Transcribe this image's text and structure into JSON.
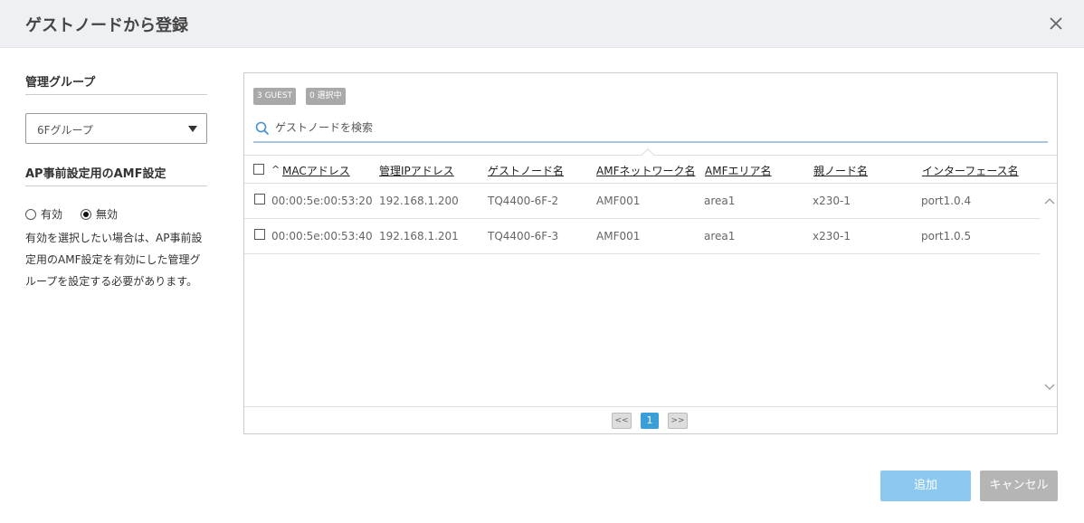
{
  "dialog": {
    "title": "ゲストノードから登録"
  },
  "left": {
    "group_title": "管理グループ",
    "group_select_value": "6Fグループ",
    "amf_title": "AP事前設定用のAMF設定",
    "radio_enable": "有効",
    "radio_disable": "無効",
    "radio_selected": "無効",
    "note": "有効を選択したい場合は、AP事前設定用のAMF設定を有効にした管理グループを設定する必要があります。"
  },
  "panel": {
    "badges": [
      "3 GUEST",
      "0 選択中"
    ],
    "search_placeholder": "ゲストノードを検索",
    "columns": [
      "MACアドレス",
      "管理IPアドレス",
      "ゲストノード名",
      "AMFネットワーク名",
      "AMFエリア名",
      "親ノード名",
      "インターフェース名"
    ],
    "rows": [
      [
        "00:00:5e:00:53:20",
        "192.168.1.200",
        "TQ4400-6F-2",
        "AMF001",
        "area1",
        "x230-1",
        "port1.0.4"
      ],
      [
        "00:00:5e:00:53:40",
        "192.168.1.201",
        "TQ4400-6F-3",
        "AMF001",
        "area1",
        "x230-1",
        "port1.0.5"
      ]
    ],
    "pager": {
      "first": "<<",
      "current": "1",
      "next": ">>"
    }
  },
  "buttons": {
    "add": "追加",
    "cancel": "キャンセル"
  },
  "colors": {
    "accent": "#3a9fd6",
    "add_button": "#8cc8f0",
    "cancel_button": "#b5b5b5"
  }
}
